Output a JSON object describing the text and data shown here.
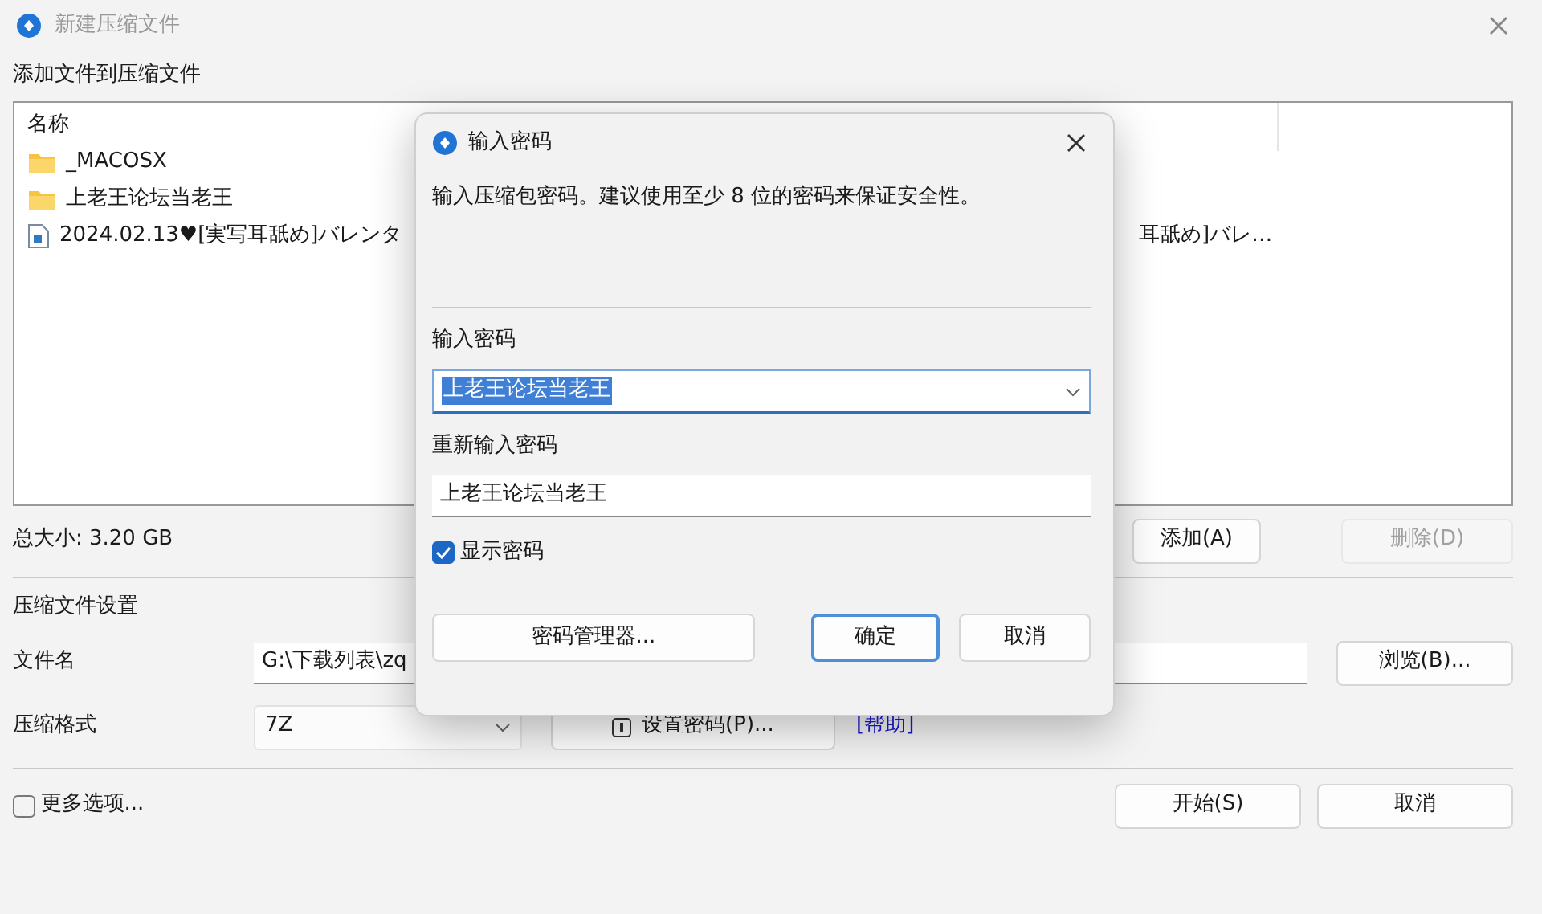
{
  "window": {
    "title": "新建压缩文件",
    "active": false
  },
  "add_heading": "添加文件到压缩文件",
  "file_list": {
    "columns": [
      "名称"
    ],
    "rows": [
      {
        "kind": "folder",
        "name": "_MACOSX"
      },
      {
        "kind": "folder",
        "name": "上老王论坛当老王"
      },
      {
        "kind": "file",
        "name": "2024.02.13♥[実写耳舐め]バレンタ",
        "column_2": "耳舐め]バレ…"
      }
    ]
  },
  "total_size": "总大小: 3.20 GB",
  "list_buttons": [
    {
      "label": "添加(A)",
      "disabled": false
    },
    {
      "label": "删除(D)",
      "disabled": true
    }
  ],
  "settings_heading": "压缩文件设置",
  "filename": {
    "label": "文件名",
    "value": "G:\\下载列表\\zq"
  },
  "browse_button": "浏览(B)...",
  "format": {
    "label": "压缩格式",
    "value": "7Z"
  },
  "set_password_button": "设置密码(P)...",
  "help_link": "[帮助]",
  "more_options": {
    "label": "更多选项...",
    "checked": false
  },
  "footer_buttons": [
    {
      "label": "开始(S)"
    },
    {
      "label": "取消"
    }
  ],
  "dialog": {
    "title": "输入密码",
    "message": "输入压缩包密码。建议使用至少 8 位的密码来保证安全性。",
    "password_label": "输入密码",
    "password_value": "上老王论坛当老王",
    "password_selected": true,
    "confirm_label": "重新输入密码",
    "confirm_value": "上老王论坛当老王",
    "show_password": {
      "label": "显示密码",
      "checked": true
    },
    "buttons": [
      {
        "label": "密码管理器...",
        "default": false
      },
      {
        "label": "确定",
        "default": true
      },
      {
        "label": "取消",
        "default": false
      }
    ]
  }
}
